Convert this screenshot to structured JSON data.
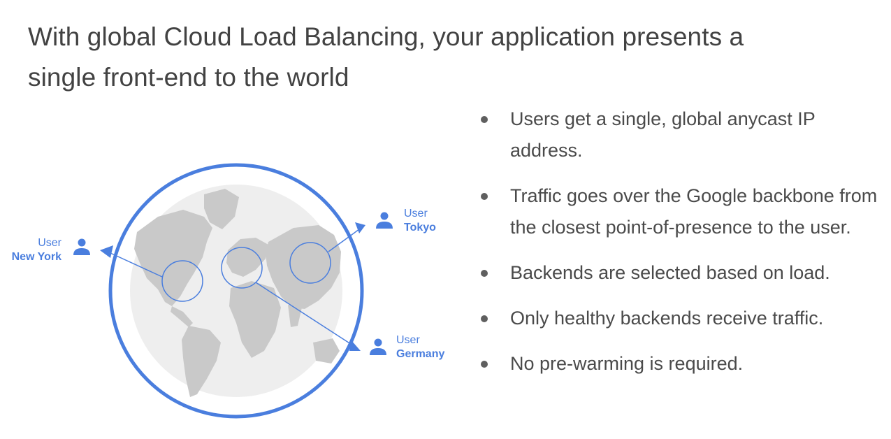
{
  "title": {
    "line1": "With global Cloud Load Balancing, your application presents a",
    "line2": "single front-end to the world"
  },
  "users": {
    "new_york": {
      "label": "User",
      "city": "New York"
    },
    "tokyo": {
      "label": "User",
      "city": "Tokyo"
    },
    "germany": {
      "label": "User",
      "city": "Germany"
    }
  },
  "bullets": [
    "Users get a single, global anycast IP address.",
    "Traffic goes over the Google backbone from the closest point-of-presence to the user.",
    "Backends are selected based on load.",
    "Only healthy backends receive traffic.",
    "No pre-warming is required."
  ],
  "colors": {
    "accent": "#4a7ede",
    "globe": "#eeeeee",
    "land": "#c8c8c8",
    "text": "#424242"
  },
  "icons": [
    "user-icon",
    "globe",
    "region-circle",
    "arrowhead"
  ]
}
